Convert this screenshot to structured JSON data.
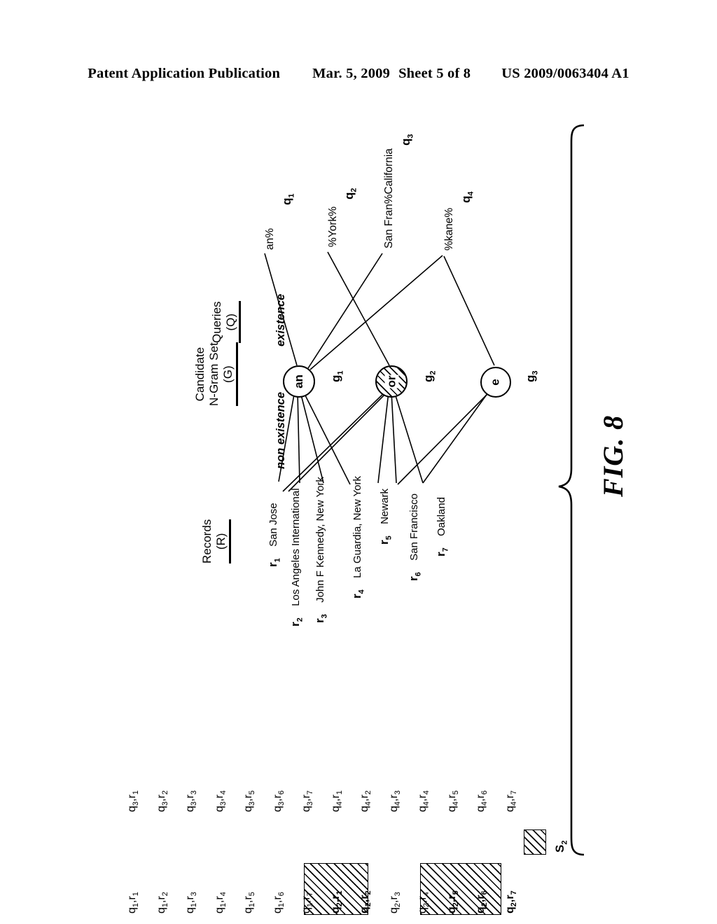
{
  "header": {
    "publication": "Patent Application Publication",
    "date": "Mar. 5, 2009",
    "sheet": "Sheet 5 of 8",
    "patent_number": "US 2009/0063404 A1"
  },
  "figure": {
    "caption": "FIG. 8",
    "sections": {
      "queries": {
        "title_line1": "Queries",
        "title_line2": "(Q)"
      },
      "ngrams": {
        "title_line1": "Candidate",
        "title_line2": "N-Gram Set",
        "title_line3": "(G)"
      },
      "records": {
        "title_line1": "Records",
        "title_line2": "(R)"
      }
    },
    "edge_labels": {
      "existence": "existence",
      "non_existence": "non existence"
    },
    "queries": [
      {
        "id": "q",
        "sub": "1",
        "text": "an%"
      },
      {
        "id": "q",
        "sub": "2",
        "text": "%York%"
      },
      {
        "id": "q",
        "sub": "3",
        "text": "San Fran%California"
      },
      {
        "id": "q",
        "sub": "4",
        "text": "%kane%"
      }
    ],
    "ngrams": [
      {
        "id": "g",
        "sub": "1",
        "text": "an",
        "hatched": false
      },
      {
        "id": "g",
        "sub": "2",
        "text": "or",
        "hatched": true
      },
      {
        "id": "g",
        "sub": "3",
        "text": "e",
        "hatched": false
      }
    ],
    "records": [
      {
        "id": "r",
        "sub": "1",
        "text": "San Jose"
      },
      {
        "id": "r",
        "sub": "2",
        "text": "Los Angeles International"
      },
      {
        "id": "r",
        "sub": "3",
        "text": "John F Kennedy, New York"
      },
      {
        "id": "r",
        "sub": "4",
        "text": "La Guardia, New York"
      },
      {
        "id": "r",
        "sub": "5",
        "text": "Newark"
      },
      {
        "id": "r",
        "sub": "6",
        "text": "San Francisco"
      },
      {
        "id": "r",
        "sub": "7",
        "text": "Oakland"
      }
    ],
    "legend": {
      "swatch_label": "S",
      "swatch_sub": "2"
    },
    "pairs_row_bottom": [
      "q1,r1",
      "q1,r2",
      "q1,r3",
      "q1,r4",
      "q1,r5",
      "q1,r6",
      "q1,r7",
      "q2,r1",
      "q2,r2",
      "q2,r3",
      "q2,r4",
      "q2,r5",
      "q2,r6",
      "q2,r7"
    ],
    "pairs_row_top": [
      "q3,r1",
      "q3,r2",
      "q3,r3",
      "q3,r4",
      "q3,r5",
      "q3,r6",
      "q3,r7",
      "q4,r1",
      "q4,r2",
      "q4,r3",
      "q4,r4",
      "q4,r5",
      "q4,r6",
      "q4,r7"
    ],
    "highlighted_pairs": [
      "q2,r1",
      "q2,r2",
      "q2,r5",
      "q2,r6",
      "q2,r7"
    ],
    "colors": {
      "ink": "#000000",
      "paper": "#ffffff"
    }
  }
}
